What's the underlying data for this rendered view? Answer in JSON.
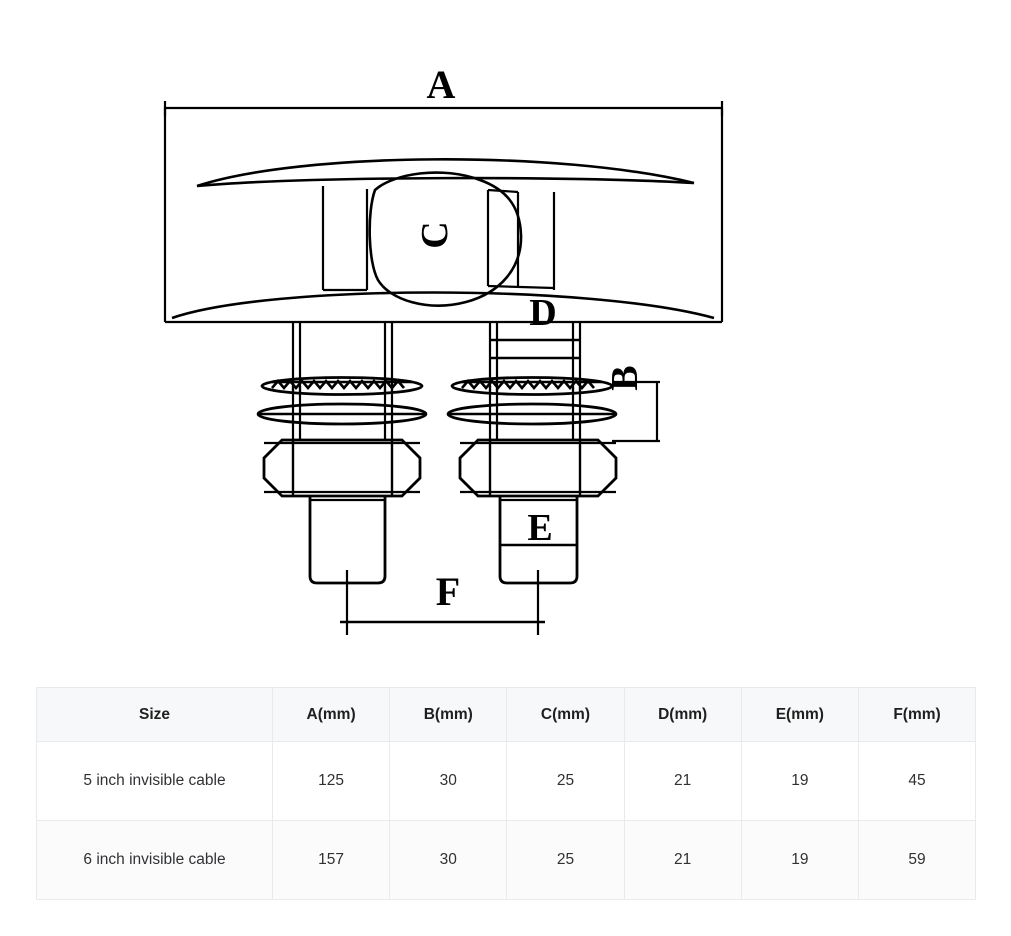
{
  "drawing": {
    "title": "invisible-cable-mount-technical-drawing",
    "dimension_labels": {
      "A": "A",
      "B": "B",
      "C": "C",
      "D": "D",
      "E": "E",
      "F": "F"
    },
    "line_color": "#000000",
    "background": "#ffffff"
  },
  "table": {
    "headers": [
      "Size",
      "A(mm)",
      "B(mm)",
      "C(mm)",
      "D(mm)",
      "E(mm)",
      "F(mm)"
    ],
    "rows": [
      {
        "size": "5 inch invisible cable",
        "a": "125",
        "b": "30",
        "c": "25",
        "d": "21",
        "e": "19",
        "f": "45"
      },
      {
        "size": "6 inch invisible cable",
        "a": "157",
        "b": "30",
        "c": "25",
        "d": "21",
        "e": "19",
        "f": "59"
      }
    ],
    "header_background": "#f7f8f9",
    "border_color": "#e8eaec"
  }
}
